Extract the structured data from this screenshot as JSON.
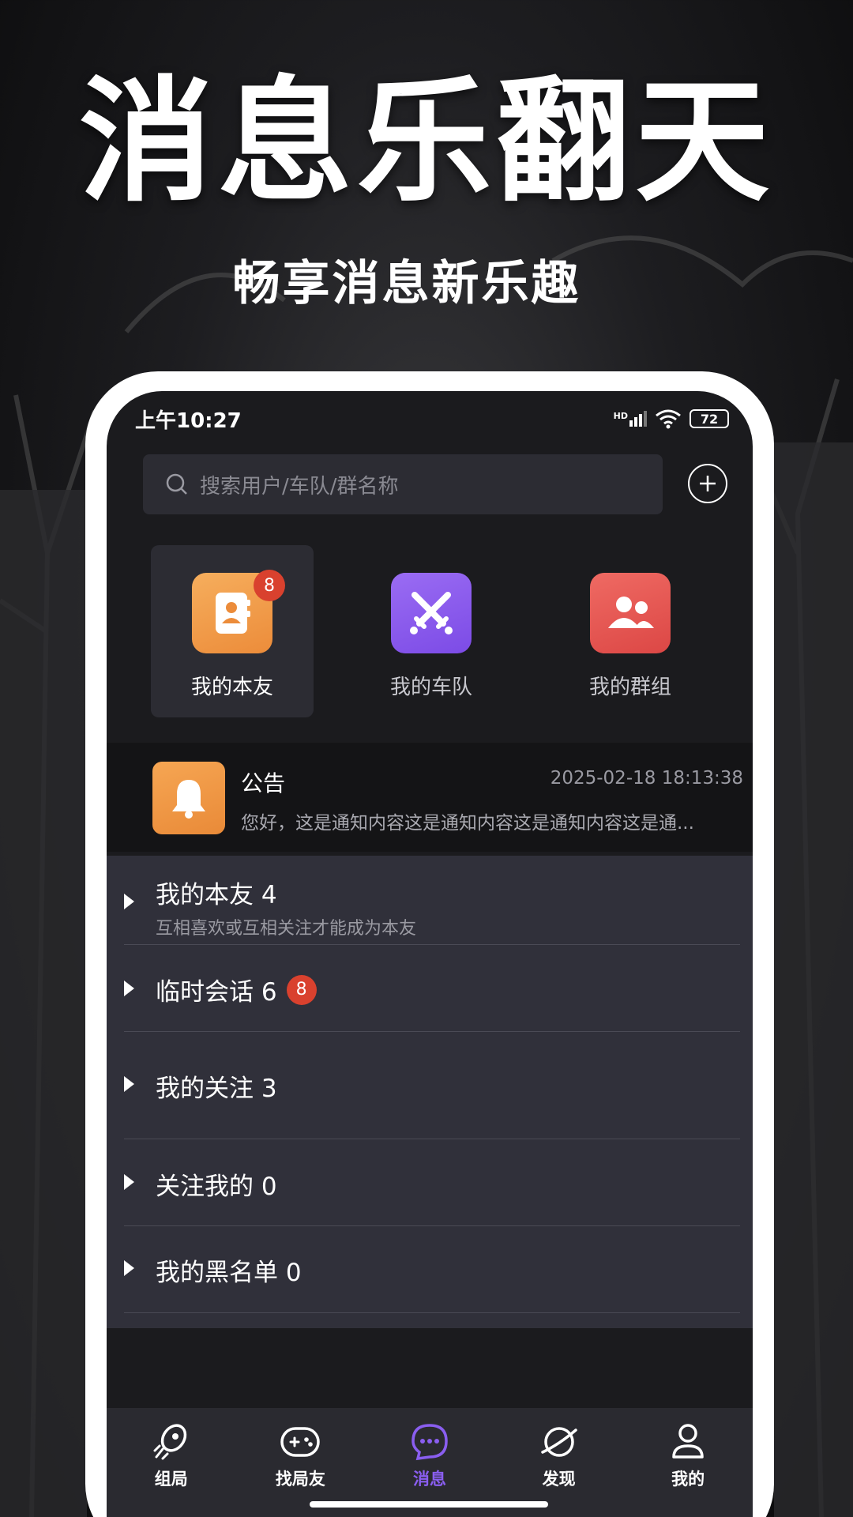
{
  "promo": {
    "headline": "消息乐翻天",
    "subhead": "畅享消息新乐趣"
  },
  "status_bar": {
    "time": "上午10:27",
    "network": "HD",
    "battery": "72"
  },
  "search": {
    "placeholder": "搜索用户/车队/群名称"
  },
  "quick_entries": [
    {
      "label": "我的本友",
      "badge": "8",
      "color": "#f3a04d",
      "icon": "address-book-icon"
    },
    {
      "label": "我的车队",
      "color": "#8b5cf0",
      "icon": "crossed-swords-icon"
    },
    {
      "label": "我的群组",
      "color": "#e5534f",
      "icon": "group-users-icon"
    }
  ],
  "notice": {
    "title": "公告",
    "date": "2025-02-18 18:13:38",
    "message": "您好，这是通知内容这是通知内容这是通知内容这是通..."
  },
  "groups": [
    {
      "name": "我的本友 4",
      "subtitle": "互相喜欢或互相关注才能成为本友"
    },
    {
      "name": "临时会话 6",
      "badge": "8"
    },
    {
      "name": "我的关注 3"
    },
    {
      "name": "关注我的 0"
    },
    {
      "name": "我的黑名单 0"
    }
  ],
  "tabs": [
    {
      "label": "组局",
      "icon": "rocket-icon"
    },
    {
      "label": "找局友",
      "icon": "gamepad-icon"
    },
    {
      "label": "消息",
      "icon": "chat-bubble-icon",
      "active": true
    },
    {
      "label": "发现",
      "icon": "planet-icon"
    },
    {
      "label": "我的",
      "icon": "user-icon"
    }
  ],
  "colors": {
    "accent": "#8a5ef0",
    "badge": "#d9412e",
    "panel": "#30303a"
  }
}
